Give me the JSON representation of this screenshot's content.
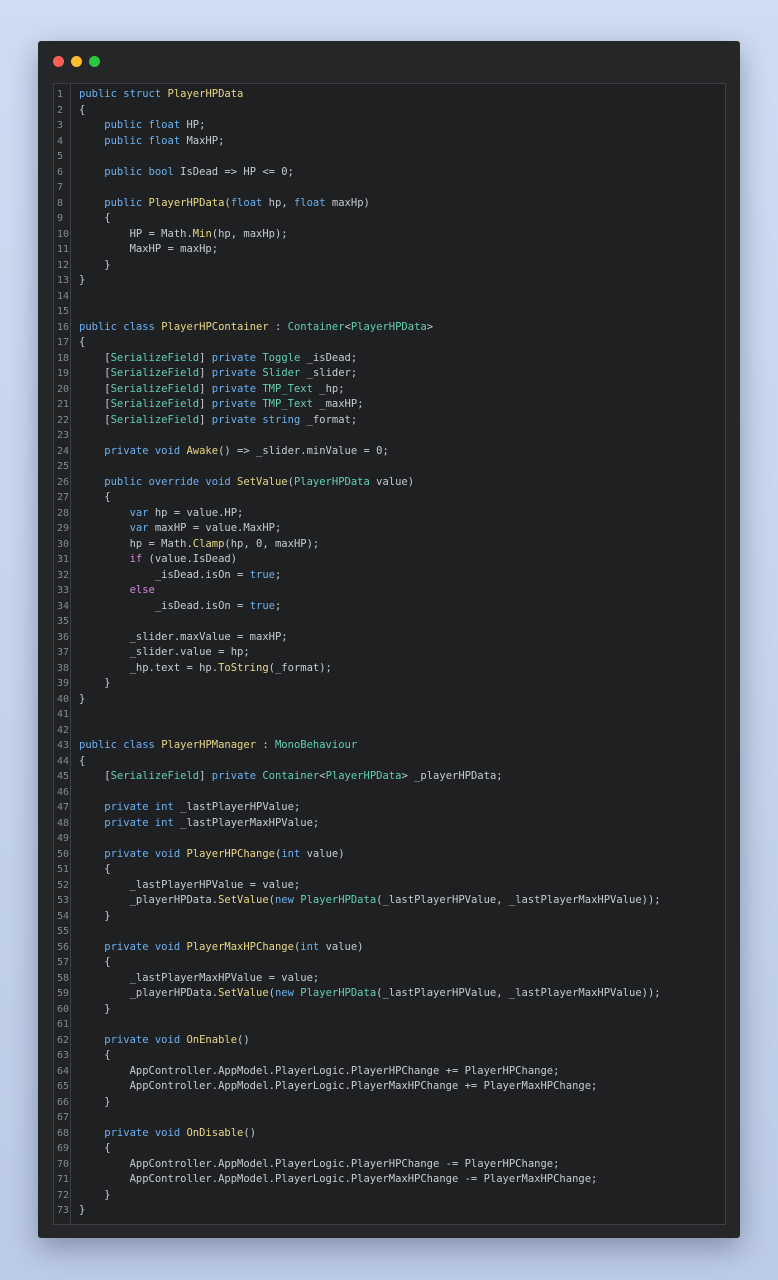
{
  "window": {
    "controls": [
      {
        "name": "close",
        "color": "#ff5f57"
      },
      {
        "name": "minimize",
        "color": "#febc2e"
      },
      {
        "name": "maximize",
        "color": "#28c840"
      }
    ]
  },
  "colors": {
    "keyword": "#6cb1f2",
    "type": "#5fd1b2",
    "function": "#e9d884",
    "control": "#d28bd8",
    "text": "#d4d7de",
    "line_number": "#858a91"
  },
  "code": {
    "lines": [
      [
        {
          "t": "public struct ",
          "c": "k"
        },
        {
          "t": "PlayerHPData",
          "c": "f"
        }
      ],
      [
        {
          "t": "{",
          "c": "p"
        }
      ],
      [
        {
          "t": "    public float ",
          "c": "k"
        },
        {
          "t": "HP;",
          "c": "p"
        }
      ],
      [
        {
          "t": "    public float ",
          "c": "k"
        },
        {
          "t": "MaxHP;",
          "c": "p"
        }
      ],
      [],
      [
        {
          "t": "    public bool ",
          "c": "k"
        },
        {
          "t": "IsDead => HP <= 0;",
          "c": "p"
        }
      ],
      [],
      [
        {
          "t": "    public ",
          "c": "k"
        },
        {
          "t": "PlayerHPData",
          "c": "f"
        },
        {
          "t": "(",
          "c": "p"
        },
        {
          "t": "float ",
          "c": "k"
        },
        {
          "t": "hp, ",
          "c": "p"
        },
        {
          "t": "float ",
          "c": "k"
        },
        {
          "t": "maxHp)",
          "c": "p"
        }
      ],
      [
        {
          "t": "    {",
          "c": "p"
        }
      ],
      [
        {
          "t": "        HP = Math.",
          "c": "p"
        },
        {
          "t": "Min",
          "c": "f"
        },
        {
          "t": "(hp, maxHp);",
          "c": "p"
        }
      ],
      [
        {
          "t": "        MaxHP = maxHp;",
          "c": "p"
        }
      ],
      [
        {
          "t": "    }",
          "c": "p"
        }
      ],
      [
        {
          "t": "}",
          "c": "p"
        }
      ],
      [],
      [],
      [
        {
          "t": "public class ",
          "c": "k"
        },
        {
          "t": "PlayerHPContainer",
          "c": "f"
        },
        {
          "t": " : ",
          "c": "p"
        },
        {
          "t": "Container",
          "c": "t"
        },
        {
          "t": "<",
          "c": "p"
        },
        {
          "t": "PlayerHPData",
          "c": "t"
        },
        {
          "t": ">",
          "c": "p"
        }
      ],
      [
        {
          "t": "{",
          "c": "p"
        }
      ],
      [
        {
          "t": "    [",
          "c": "p"
        },
        {
          "t": "SerializeField",
          "c": "t"
        },
        {
          "t": "] ",
          "c": "p"
        },
        {
          "t": "private ",
          "c": "k"
        },
        {
          "t": "Toggle ",
          "c": "t"
        },
        {
          "t": "_isDead;",
          "c": "p"
        }
      ],
      [
        {
          "t": "    [",
          "c": "p"
        },
        {
          "t": "SerializeField",
          "c": "t"
        },
        {
          "t": "] ",
          "c": "p"
        },
        {
          "t": "private ",
          "c": "k"
        },
        {
          "t": "Slider ",
          "c": "t"
        },
        {
          "t": "_slider;",
          "c": "p"
        }
      ],
      [
        {
          "t": "    [",
          "c": "p"
        },
        {
          "t": "SerializeField",
          "c": "t"
        },
        {
          "t": "] ",
          "c": "p"
        },
        {
          "t": "private ",
          "c": "k"
        },
        {
          "t": "TMP_Text ",
          "c": "t"
        },
        {
          "t": "_hp;",
          "c": "p"
        }
      ],
      [
        {
          "t": "    [",
          "c": "p"
        },
        {
          "t": "SerializeField",
          "c": "t"
        },
        {
          "t": "] ",
          "c": "p"
        },
        {
          "t": "private ",
          "c": "k"
        },
        {
          "t": "TMP_Text ",
          "c": "t"
        },
        {
          "t": "_maxHP;",
          "c": "p"
        }
      ],
      [
        {
          "t": "    [",
          "c": "p"
        },
        {
          "t": "SerializeField",
          "c": "t"
        },
        {
          "t": "] ",
          "c": "p"
        },
        {
          "t": "private string ",
          "c": "k"
        },
        {
          "t": "_format;",
          "c": "p"
        }
      ],
      [],
      [
        {
          "t": "    private void ",
          "c": "k"
        },
        {
          "t": "Awake",
          "c": "f"
        },
        {
          "t": "() => _slider.minValue = 0;",
          "c": "p"
        }
      ],
      [],
      [
        {
          "t": "    public override void ",
          "c": "k"
        },
        {
          "t": "SetValue",
          "c": "f"
        },
        {
          "t": "(",
          "c": "p"
        },
        {
          "t": "PlayerHPData ",
          "c": "t"
        },
        {
          "t": "value)",
          "c": "p"
        }
      ],
      [
        {
          "t": "    {",
          "c": "p"
        }
      ],
      [
        {
          "t": "        var ",
          "c": "k"
        },
        {
          "t": "hp = value.HP;",
          "c": "p"
        }
      ],
      [
        {
          "t": "        var ",
          "c": "k"
        },
        {
          "t": "maxHP = value.MaxHP;",
          "c": "p"
        }
      ],
      [
        {
          "t": "        hp = Math.",
          "c": "p"
        },
        {
          "t": "Clamp",
          "c": "f"
        },
        {
          "t": "(hp, 0, maxHP);",
          "c": "p"
        }
      ],
      [
        {
          "t": "        if ",
          "c": "ctl"
        },
        {
          "t": "(value.IsDead)",
          "c": "p"
        }
      ],
      [
        {
          "t": "            _isDead.isOn = ",
          "c": "p"
        },
        {
          "t": "true",
          "c": "k"
        },
        {
          "t": ";",
          "c": "p"
        }
      ],
      [
        {
          "t": "        else",
          "c": "ctl"
        }
      ],
      [
        {
          "t": "            _isDead.isOn = ",
          "c": "p"
        },
        {
          "t": "true",
          "c": "k"
        },
        {
          "t": ";",
          "c": "p"
        }
      ],
      [],
      [
        {
          "t": "        _slider.maxValue = maxHP;",
          "c": "p"
        }
      ],
      [
        {
          "t": "        _slider.value = hp;",
          "c": "p"
        }
      ],
      [
        {
          "t": "        _hp.text = hp.",
          "c": "p"
        },
        {
          "t": "ToString",
          "c": "f"
        },
        {
          "t": "(_format);",
          "c": "p"
        }
      ],
      [
        {
          "t": "    }",
          "c": "p"
        }
      ],
      [
        {
          "t": "}",
          "c": "p"
        }
      ],
      [],
      [],
      [
        {
          "t": "public class ",
          "c": "k"
        },
        {
          "t": "PlayerHPManager",
          "c": "f"
        },
        {
          "t": " : ",
          "c": "p"
        },
        {
          "t": "MonoBehaviour",
          "c": "t"
        }
      ],
      [
        {
          "t": "{",
          "c": "p"
        }
      ],
      [
        {
          "t": "    [",
          "c": "p"
        },
        {
          "t": "SerializeField",
          "c": "t"
        },
        {
          "t": "] ",
          "c": "p"
        },
        {
          "t": "private ",
          "c": "k"
        },
        {
          "t": "Container",
          "c": "t"
        },
        {
          "t": "<",
          "c": "p"
        },
        {
          "t": "PlayerHPData",
          "c": "t"
        },
        {
          "t": "> _playerHPData;",
          "c": "p"
        }
      ],
      [],
      [
        {
          "t": "    private int ",
          "c": "k"
        },
        {
          "t": "_lastPlayerHPValue;",
          "c": "p"
        }
      ],
      [
        {
          "t": "    private int ",
          "c": "k"
        },
        {
          "t": "_lastPlayerMaxHPValue;",
          "c": "p"
        }
      ],
      [],
      [
        {
          "t": "    private void ",
          "c": "k"
        },
        {
          "t": "PlayerHPChange",
          "c": "f"
        },
        {
          "t": "(",
          "c": "p"
        },
        {
          "t": "int ",
          "c": "k"
        },
        {
          "t": "value)",
          "c": "p"
        }
      ],
      [
        {
          "t": "    {",
          "c": "p"
        }
      ],
      [
        {
          "t": "        _lastPlayerHPValue = value;",
          "c": "p"
        }
      ],
      [
        {
          "t": "        _playerHPData.",
          "c": "p"
        },
        {
          "t": "SetValue",
          "c": "f"
        },
        {
          "t": "(",
          "c": "p"
        },
        {
          "t": "new ",
          "c": "k"
        },
        {
          "t": "PlayerHPData",
          "c": "t"
        },
        {
          "t": "(_lastPlayerHPValue, _lastPlayerMaxHPValue));",
          "c": "p"
        }
      ],
      [
        {
          "t": "    }",
          "c": "p"
        }
      ],
      [],
      [
        {
          "t": "    private void ",
          "c": "k"
        },
        {
          "t": "PlayerMaxHPChange",
          "c": "f"
        },
        {
          "t": "(",
          "c": "p"
        },
        {
          "t": "int ",
          "c": "k"
        },
        {
          "t": "value)",
          "c": "p"
        }
      ],
      [
        {
          "t": "    {",
          "c": "p"
        }
      ],
      [
        {
          "t": "        _lastPlayerMaxHPValue = value;",
          "c": "p"
        }
      ],
      [
        {
          "t": "        _playerHPData.",
          "c": "p"
        },
        {
          "t": "SetValue",
          "c": "f"
        },
        {
          "t": "(",
          "c": "p"
        },
        {
          "t": "new ",
          "c": "k"
        },
        {
          "t": "PlayerHPData",
          "c": "t"
        },
        {
          "t": "(_lastPlayerHPValue, _lastPlayerMaxHPValue));",
          "c": "p"
        }
      ],
      [
        {
          "t": "    }",
          "c": "p"
        }
      ],
      [],
      [
        {
          "t": "    private void ",
          "c": "k"
        },
        {
          "t": "OnEnable",
          "c": "f"
        },
        {
          "t": "()",
          "c": "p"
        }
      ],
      [
        {
          "t": "    {",
          "c": "p"
        }
      ],
      [
        {
          "t": "        AppController.AppModel.PlayerLogic.PlayerHPChange += PlayerHPChange;",
          "c": "p"
        }
      ],
      [
        {
          "t": "        AppController.AppModel.PlayerLogic.PlayerMaxHPChange += PlayerMaxHPChange;",
          "c": "p"
        }
      ],
      [
        {
          "t": "    }",
          "c": "p"
        }
      ],
      [],
      [
        {
          "t": "    private void ",
          "c": "k"
        },
        {
          "t": "OnDisable",
          "c": "f"
        },
        {
          "t": "()",
          "c": "p"
        }
      ],
      [
        {
          "t": "    {",
          "c": "p"
        }
      ],
      [
        {
          "t": "        AppController.AppModel.PlayerLogic.PlayerHPChange -= PlayerHPChange;",
          "c": "p"
        }
      ],
      [
        {
          "t": "        AppController.AppModel.PlayerLogic.PlayerMaxHPChange -= PlayerMaxHPChange;",
          "c": "p"
        }
      ],
      [
        {
          "t": "    }",
          "c": "p"
        }
      ],
      [
        {
          "t": "}",
          "c": "p"
        }
      ]
    ]
  }
}
